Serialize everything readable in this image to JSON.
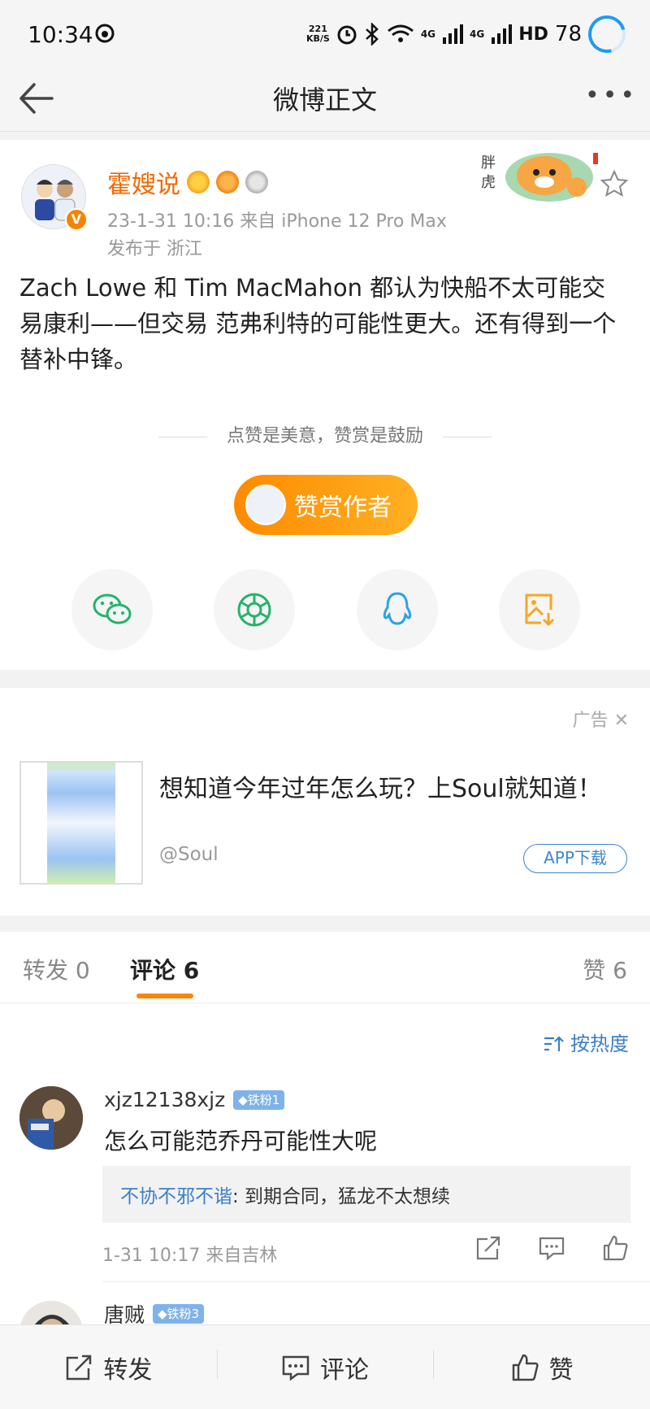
{
  "status_bar": {
    "time": "10:34",
    "net_speed_value": "221",
    "net_speed_unit": "KB/S",
    "network_a": "4G",
    "network_b": "4G",
    "hd": "HD",
    "battery": "78"
  },
  "nav": {
    "title": "微博正文",
    "more": "•••"
  },
  "post": {
    "author": "霍嫂说",
    "verified_mark": "V",
    "meta": "23-1-31 10:16  来自 iPhone 12 Pro Max",
    "location": "发布于 浙江",
    "text": "Zach Lowe 和 Tim MacMahon 都认为快船不太可能交易康利——但交易 范弗利特的可能性更大。还有得到一个替补中锋。",
    "reward_hint": "点赞是美意，赞赏是鼓励",
    "reward_button": "赞赏作者",
    "share_icons": [
      "wechat-icon",
      "moments-icon",
      "qq-icon",
      "save-image-icon"
    ]
  },
  "ad": {
    "label": "广告",
    "close": "✕",
    "title": "想知道今年过年怎么玩？上Soul就知道！",
    "source": "@Soul",
    "button": "APP下载"
  },
  "tabs": {
    "forward": "转发 0",
    "comment": "评论 6",
    "like": "赞 6",
    "accent_color": "#ff8200"
  },
  "comments": {
    "sort": "按热度",
    "items": [
      {
        "name": "xjz12138xjz",
        "badge": "◆铁粉1",
        "text": "怎么可能范乔丹可能性大呢",
        "reply_user": "不协不邪不谐",
        "reply_text": ": 到期合同，猛龙不太想续",
        "meta": "1-31 10:17  来自吉林"
      },
      {
        "name": "唐贼",
        "badge": "◆铁粉3"
      }
    ]
  },
  "bottom_bar": {
    "forward": "转发",
    "comment": "评论",
    "like": "赞"
  }
}
